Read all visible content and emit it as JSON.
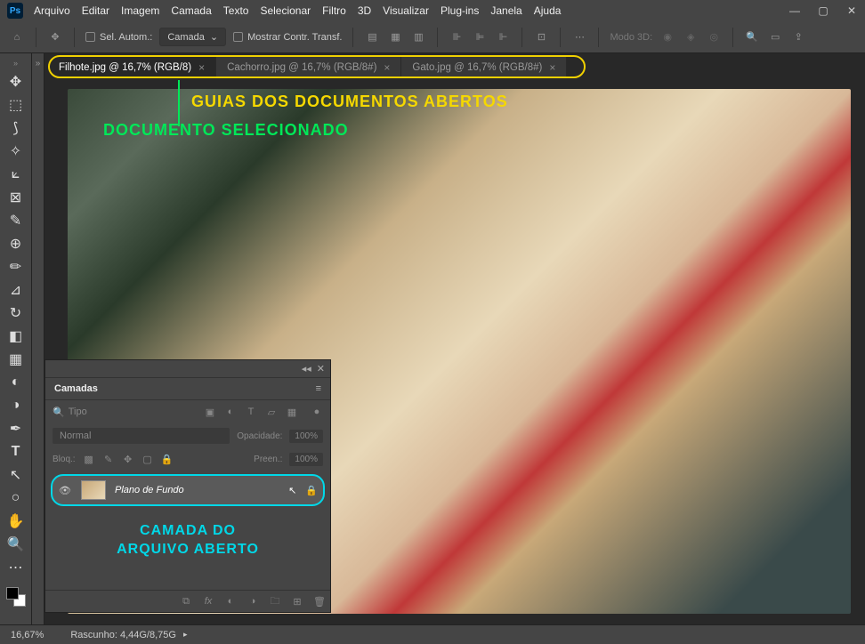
{
  "menubar": {
    "logo": "Ps",
    "items": [
      "Arquivo",
      "Editar",
      "Imagem",
      "Camada",
      "Texto",
      "Selecionar",
      "Filtro",
      "3D",
      "Visualizar",
      "Plug-ins",
      "Janela",
      "Ajuda"
    ]
  },
  "optbar": {
    "sel_autom": "Sel. Autom.:",
    "camada": "Camada",
    "mostrar": "Mostrar Contr. Transf.",
    "modo3d": "Modo 3D:"
  },
  "tabs": [
    {
      "label": "Filhote.jpg @ 16,7% (RGB/8)",
      "active": true
    },
    {
      "label": "Cachorro.jpg @ 16,7% (RGB/8#)",
      "active": false
    },
    {
      "label": "Gato.jpg @ 16,7% (RGB/8#)",
      "active": false
    }
  ],
  "annotations": {
    "yellow": "GUIAS DOS DOCUMENTOS ABERTOS",
    "green": "DOCUMENTO SELECIONADO",
    "cyan1": "CAMADA DO",
    "cyan2": "ARQUIVO ABERTO"
  },
  "panel": {
    "title": "Camadas",
    "tipo": "Tipo",
    "normal": "Normal",
    "opacidade": "Opacidade:",
    "opa_val": "100%",
    "bloq": "Bloq.:",
    "preen": "Preen.:",
    "preen_val": "100%",
    "layer_name": "Plano de Fundo"
  },
  "statusbar": {
    "zoom": "16,67%",
    "rascunho": "Rascunho: 4,44G/8,75G"
  }
}
